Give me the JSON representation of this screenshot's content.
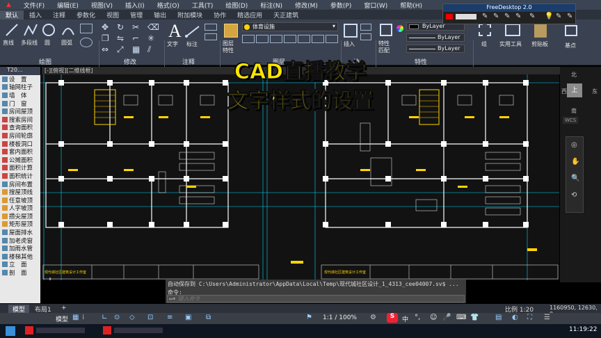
{
  "menubar": {
    "items": [
      "文件(F)",
      "编辑(E)",
      "视图(V)",
      "插入(I)",
      "格式(O)",
      "工具(T)",
      "绘图(D)",
      "标注(N)",
      "修改(M)",
      "参数(P)",
      "窗口(W)",
      "帮助(H)"
    ]
  },
  "tabs": [
    "默认",
    "插入",
    "注释",
    "参数化",
    "视图",
    "管理",
    "输出",
    "附加模块",
    "协作",
    "精选应用",
    "天正建筑"
  ],
  "ribbon": {
    "draw_tools": [
      "直线",
      "多段线",
      "圆",
      "圆弧"
    ],
    "text_label": "文字",
    "dim_label": "标注",
    "layer_props_label": "图层\n特性",
    "layer_current": "体育设施",
    "insert_label": "插入",
    "props_label": "特性\n匹配",
    "bylayer": [
      "ByLayer",
      "ByLayer",
      "ByLayer"
    ],
    "group_label": "组",
    "util_label": "实用工具",
    "clip_label": "剪贴板",
    "base_label": "基点",
    "panels": [
      "绘图",
      "修改",
      "注释",
      "图层",
      "块",
      "特性"
    ]
  },
  "freedesktop": {
    "title": "FreeDesktop 2.0"
  },
  "window_tab": "[-][俯视][二维线框]",
  "left_palette": {
    "header": "T20...",
    "items": [
      "设　置",
      "轴网柱子",
      "墙　体",
      "门　窗",
      "房间屋顶",
      "搜索房间",
      "查询面积",
      "房间轮廓",
      "楼板洞口",
      "套内面积",
      "公摊面积",
      "面积计算",
      "面积统计",
      "房间布置",
      "搜屋顶线",
      "任意坡顶",
      "人字坡顶",
      "攒尖屋顶",
      "矩形屋顶",
      "屋面排水",
      "加老虎窗",
      "加雨水管",
      "楼梯其他",
      "立　面",
      "剖　面"
    ]
  },
  "overlay": {
    "line1": "CAD直播教学",
    "line2": "文字样式的设置"
  },
  "navcube": {
    "north": "北",
    "south": "南",
    "east": "东",
    "west": "西",
    "top": "上",
    "wcs": "WCS"
  },
  "command": {
    "history": "自动保存到 C:\\Users\\Administrator\\AppData\\Local\\Temp\\现代城社区设计_1_4313_cee04007.sv$ ...",
    "prompt": "命令:",
    "placeholder": "键入命令"
  },
  "layout_tabs": [
    "模型",
    "布局1",
    "+"
  ],
  "status": {
    "model": "模型",
    "scale_text": "1:1 / 100%",
    "ratio": "比例 1:20",
    "coords": "1160950, 12630, 0"
  },
  "ime": {
    "lang": "中"
  },
  "clock": {
    "time": "11:19:22"
  },
  "drawing": {
    "title_block_text": "现代城社区建筑设计工作室"
  },
  "colors": {
    "accent_yellow": "#ffe600",
    "ribbon_bg": "#3a4150",
    "viewport_bg": "#121212",
    "wall": "#ffffff",
    "grid_cyan": "#00d9ff"
  }
}
